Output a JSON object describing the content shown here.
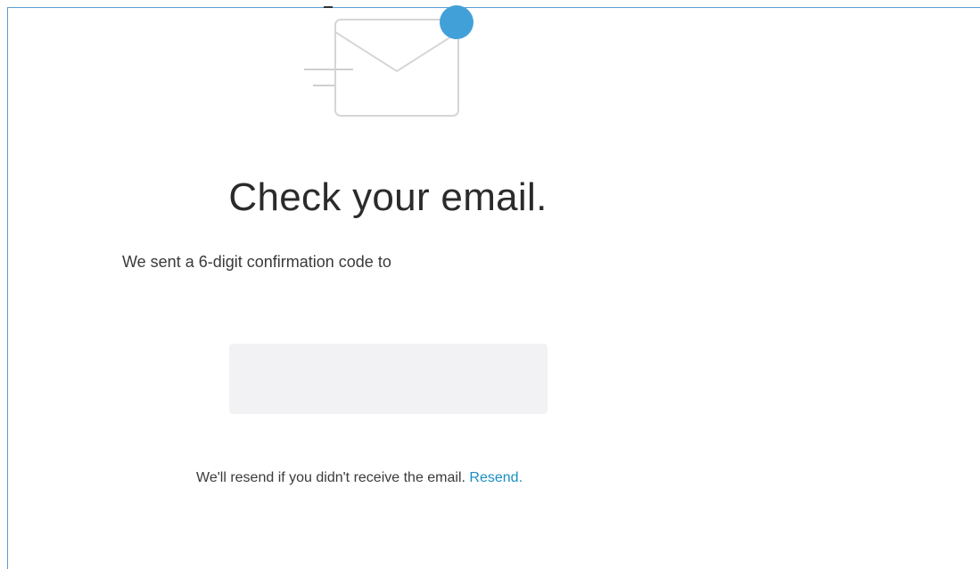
{
  "title": "Check your email.",
  "subtitle": "We sent a 6-digit confirmation code to",
  "code_input": {
    "value": "",
    "placeholder": ""
  },
  "resend": {
    "text": "We'll resend if you didn't receive the email.",
    "link_label": "Resend."
  },
  "icons": {
    "illustration": "envelope-notification-icon"
  },
  "colors": {
    "accent": "#42a0d8",
    "link": "#1a8fbf",
    "frame_border": "#5b9bd5",
    "input_background": "#f2f2f4"
  }
}
